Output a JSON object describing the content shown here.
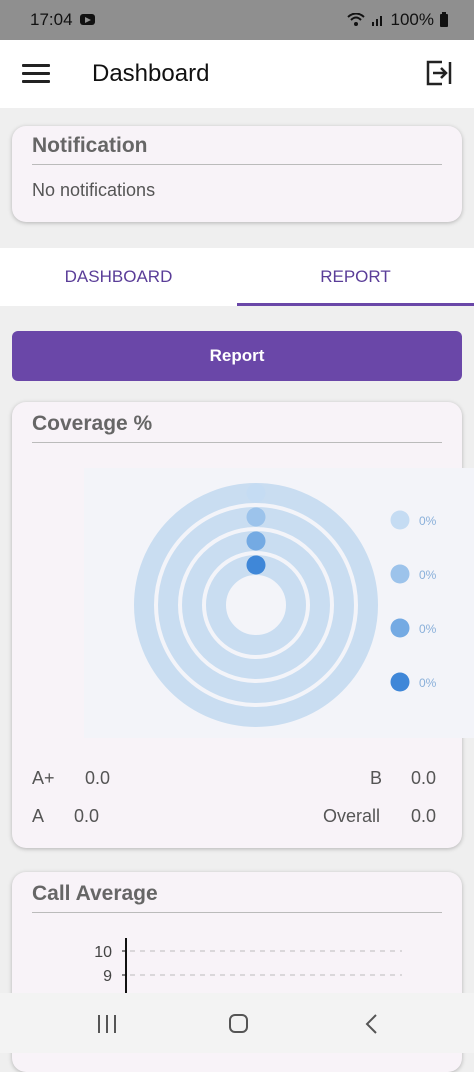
{
  "status": {
    "time": "17:04",
    "battery": "100%"
  },
  "appbar": {
    "title": "Dashboard"
  },
  "notification": {
    "title": "Notification",
    "text": "No notifications"
  },
  "tabs": [
    {
      "label": "DASHBOARD"
    },
    {
      "label": "REPORT"
    }
  ],
  "report_button": {
    "label": "Report"
  },
  "coverage": {
    "title": "Coverage %",
    "chart_data": {
      "type": "pie",
      "series": [
        {
          "color": "#c5dcf3",
          "value_label": "0%",
          "value": 0
        },
        {
          "color": "#9cc3eb",
          "value_label": "0%",
          "value": 0
        },
        {
          "color": "#74aae3",
          "value_label": "0%",
          "value": 0
        },
        {
          "color": "#3f87d8",
          "value_label": "0%",
          "value": 0
        }
      ]
    },
    "stats": {
      "a_plus_label": "A+",
      "a_plus_value": "0.0",
      "b_label": "B",
      "b_value": "0.0",
      "a_label": "A",
      "a_value": "0.0",
      "overall_label": "Overall",
      "overall_value": "0.0"
    }
  },
  "call_average": {
    "title": "Call Average",
    "chart_data": {
      "type": "line",
      "yticks": [
        "10",
        "9"
      ]
    }
  }
}
